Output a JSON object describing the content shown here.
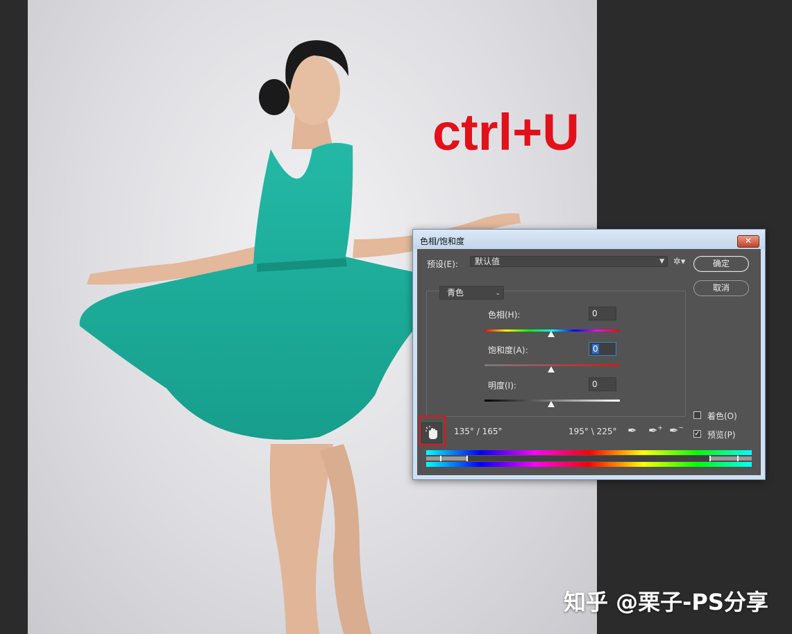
{
  "canvas": {
    "hint_text": "ctrl+U",
    "watermark": "知乎 @栗子-PS分享"
  },
  "dialog": {
    "title": "色相/饱和度",
    "close_label": "✕",
    "preset_label": "预设(E):",
    "preset_value": "默认值",
    "ok_label": "确定",
    "cancel_label": "取消",
    "channel_value": "青色",
    "hue": {
      "label": "色相(H):",
      "value": "0"
    },
    "saturation": {
      "label": "饱和度(A):",
      "value": "0"
    },
    "lightness": {
      "label": "明度(I):",
      "value": "0"
    },
    "range_left": "135° / 165°",
    "range_right": "195° \\ 225°",
    "colorize_label": "着色(O)",
    "colorize_checked": false,
    "preview_label": "预览(P)",
    "preview_checked": true
  },
  "colors": {
    "dialog_bg": "#535353",
    "highlight_box": "#e5121b",
    "hint_text": "#e3101a",
    "dress": "#1fb3a0"
  }
}
